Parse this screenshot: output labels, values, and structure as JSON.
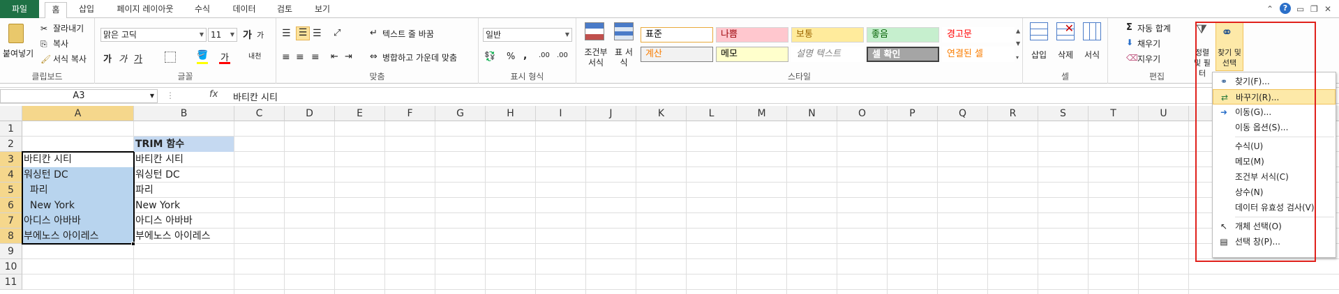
{
  "tabs": {
    "file": "파일",
    "items": [
      "홈",
      "삽입",
      "페이지 레이아웃",
      "수식",
      "데이터",
      "검토",
      "보기"
    ]
  },
  "clipboard": {
    "paste": "붙여넣기",
    "cut": "잘라내기",
    "copy": "복사",
    "format_painter": "서식 복사",
    "label": "클립보드"
  },
  "font": {
    "name": "맑은 고딕",
    "size": "11",
    "grow": "가",
    "shrink": "가",
    "bold": "가",
    "italic": "가",
    "underline": "가",
    "font_color": "가",
    "phonetic": "내천",
    "label": "글꼴"
  },
  "alignment": {
    "wrap_text": "텍스트 줄 바꿈",
    "merge_center": "병합하고 가운데 맞춤",
    "label": "맞춤"
  },
  "number": {
    "format": "일반",
    "percent": "%",
    "comma": ",",
    "inc_decimal": ".00",
    "dec_decimal": ".00",
    "label": "표시 형식"
  },
  "styles": {
    "conditional": "조건부 서식",
    "table": "표 서식",
    "cells": [
      {
        "text": "표준",
        "bg": "#ffffff",
        "fg": "#000000",
        "border": "#e8a93a"
      },
      {
        "text": "나쁨",
        "bg": "#ffc7ce",
        "fg": "#9c0006",
        "border": "#d4d4d4"
      },
      {
        "text": "보통",
        "bg": "#ffeb9c",
        "fg": "#9c6500",
        "border": "#d4d4d4"
      },
      {
        "text": "좋음",
        "bg": "#c6efce",
        "fg": "#006100",
        "border": "#d4d4d4"
      },
      {
        "text": "경고문",
        "bg": "#ffffff",
        "fg": "#ff0000",
        "border": "#ffffff"
      },
      {
        "text": "계산",
        "bg": "#f2f2f2",
        "fg": "#fa7d00",
        "border": "#7f7f7f"
      },
      {
        "text": "메모",
        "bg": "#ffffcc",
        "fg": "#000000",
        "border": "#b2b2b2"
      },
      {
        "text": "설명 텍스트",
        "bg": "#ffffff",
        "fg": "#7f7f7f",
        "border": "#ffffff"
      },
      {
        "text": "셀 확인",
        "bg": "#a5a5a5",
        "fg": "#ffffff",
        "border": "#3f3f3f"
      },
      {
        "text": "연결된 셀",
        "bg": "#ffffff",
        "fg": "#fa7d00",
        "border": "#ffffff"
      }
    ],
    "label": "스타일"
  },
  "cells_group": {
    "insert": "삽입",
    "delete": "삭제",
    "format": "서식",
    "label": "셀"
  },
  "editing": {
    "autosum": "자동 합계",
    "fill": "채우기",
    "clear": "지우기",
    "sort_filter": "정렬 및 필터",
    "find_select": "찾기 및 선택",
    "label": "편집"
  },
  "formula_bar": {
    "name_box": "A3",
    "fx": "fx",
    "content": "바티칸 시티"
  },
  "grid": {
    "columns": [
      "A",
      "B",
      "C",
      "D",
      "E",
      "F",
      "G",
      "H",
      "I",
      "J",
      "K",
      "L",
      "M",
      "N",
      "O",
      "P",
      "Q",
      "R",
      "S",
      "T",
      "U"
    ],
    "rows": [
      "1",
      "2",
      "3",
      "4",
      "5",
      "6",
      "7",
      "8",
      "9",
      "10",
      "11"
    ],
    "header_b2": "TRIM 함수",
    "col_a": [
      "바티칸 시티",
      "워싱턴 DC",
      "  파리",
      "  New York",
      "아디스 아바바",
      "부에노스 아이레스"
    ],
    "col_b": [
      "바티칸 시티",
      "워싱턴 DC",
      "파리",
      "New York",
      "아디스 아바바",
      "부에노스 아이레스"
    ]
  },
  "menu": {
    "items": [
      {
        "label": "찾기(F)...",
        "icon": "binoculars-icon",
        "highlight": false
      },
      {
        "label": "바꾸기(R)...",
        "icon": "replace-icon",
        "highlight": true
      },
      {
        "label": "이동(G)...",
        "icon": "arrow-right-icon",
        "highlight": false
      },
      {
        "label": "이동 옵션(S)...",
        "icon": "",
        "highlight": false
      },
      {
        "label": "수식(U)",
        "icon": "",
        "highlight": false
      },
      {
        "label": "메모(M)",
        "icon": "",
        "highlight": false
      },
      {
        "label": "조건부 서식(C)",
        "icon": "",
        "highlight": false
      },
      {
        "label": "상수(N)",
        "icon": "",
        "highlight": false
      },
      {
        "label": "데이터 유효성 검사(V)",
        "icon": "",
        "highlight": false
      },
      {
        "label": "개체 선택(O)",
        "icon": "cursor-icon",
        "highlight": false
      },
      {
        "label": "선택 창(P)...",
        "icon": "selection-pane-icon",
        "highlight": false
      }
    ]
  },
  "colors": {
    "file_tab": "#1e7145",
    "selection": "#b8d4ee",
    "header_highlight": "#f5d78c",
    "b2_fill": "#c5d9f1",
    "red_annotation": "#e0201b"
  }
}
